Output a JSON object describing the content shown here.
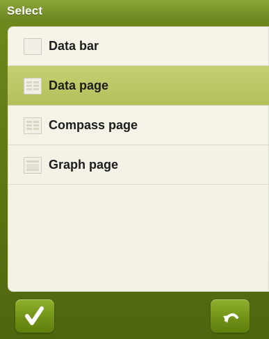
{
  "title": "Select",
  "items": [
    {
      "label": "Data bar",
      "icon": "blank-page-icon",
      "selected": false
    },
    {
      "label": "Data page",
      "icon": "data-page-icon",
      "selected": true
    },
    {
      "label": "Compass page",
      "icon": "compass-page-icon",
      "selected": false
    },
    {
      "label": "Graph page",
      "icon": "graph-page-icon",
      "selected": false
    }
  ],
  "buttons": {
    "confirm": {
      "icon": "checkmark-icon"
    },
    "back": {
      "icon": "back-arrow-icon"
    }
  },
  "colors": {
    "accent": "#6f8a1d",
    "selected_row": "#b4c05a",
    "panel": "#f4f2e6"
  }
}
